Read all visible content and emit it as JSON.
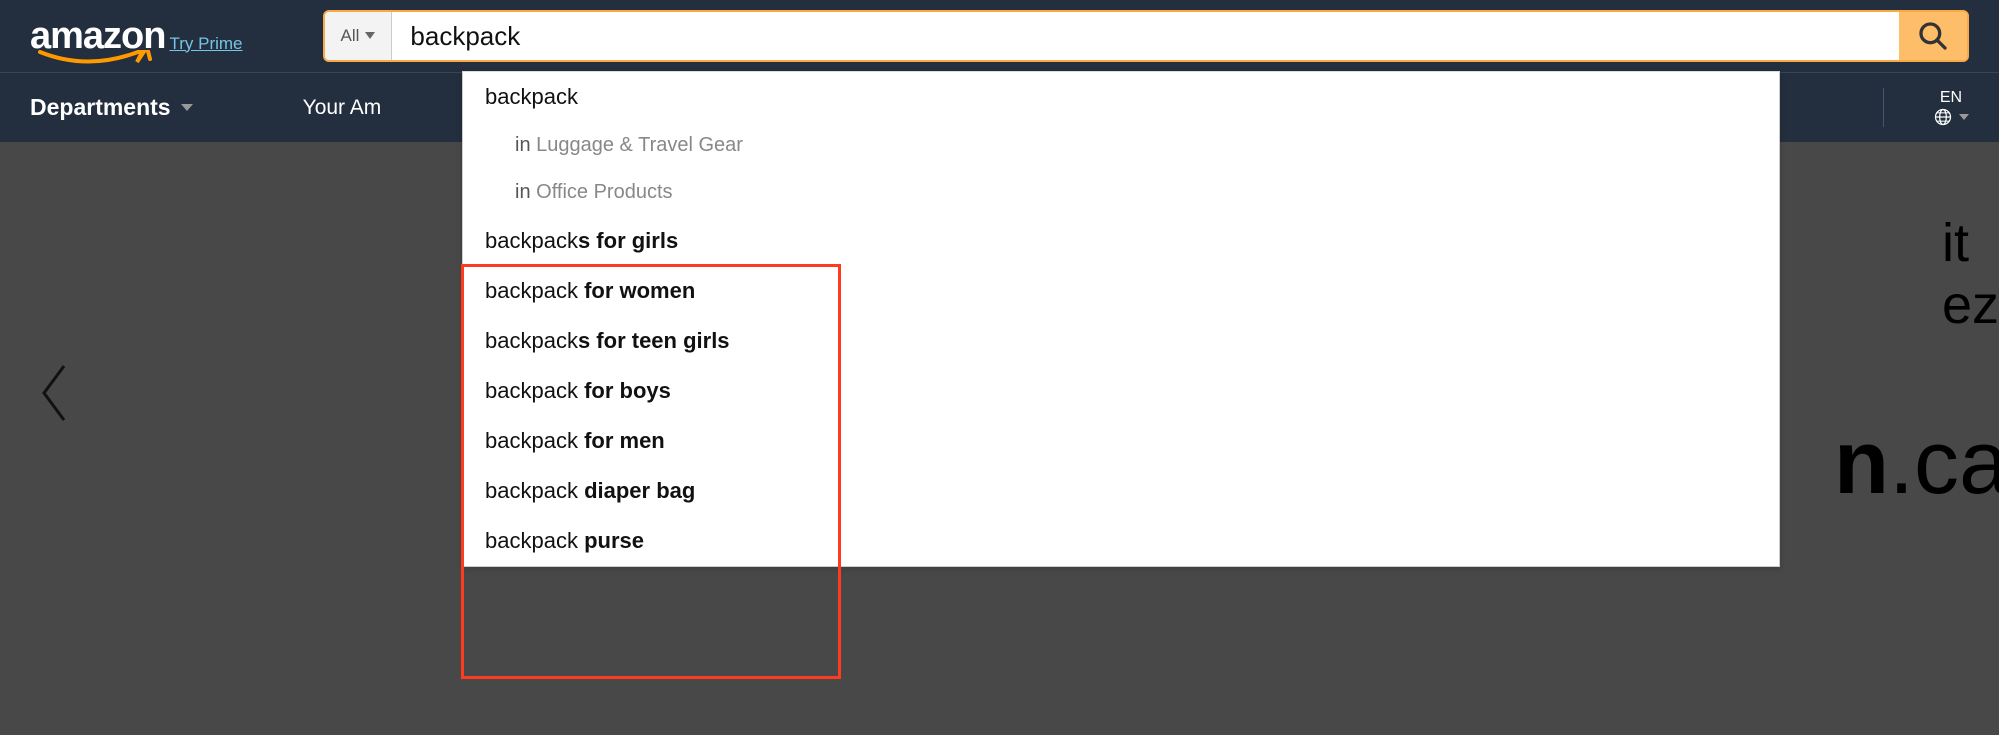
{
  "logo": "amazon",
  "try_prime": "Try Prime",
  "search": {
    "category": "All",
    "value": "backpack"
  },
  "nav": {
    "departments": "Departments",
    "your_amazon": "Your Am"
  },
  "lang": {
    "code": "EN"
  },
  "suggestions": {
    "primary": "backpack",
    "in_label": "in",
    "departments": [
      "Luggage & Travel Gear",
      "Office Products"
    ],
    "completions": [
      {
        "prefix": "backpack",
        "suffix": "s for girls"
      },
      {
        "prefix": "backpack ",
        "suffix": "for women"
      },
      {
        "prefix": "backpack",
        "suffix": "s for teen girls"
      },
      {
        "prefix": "backpack ",
        "suffix": "for boys"
      },
      {
        "prefix": "backpack ",
        "suffix": "for men"
      },
      {
        "prefix": "backpack ",
        "suffix": "diaper bag"
      },
      {
        "prefix": "backpack ",
        "suffix": "purse"
      }
    ]
  },
  "hero": {
    "line1": "it",
    "line2": "ez",
    "logo_suffix_bold": "n",
    "logo_suffix_light": ".ca"
  }
}
